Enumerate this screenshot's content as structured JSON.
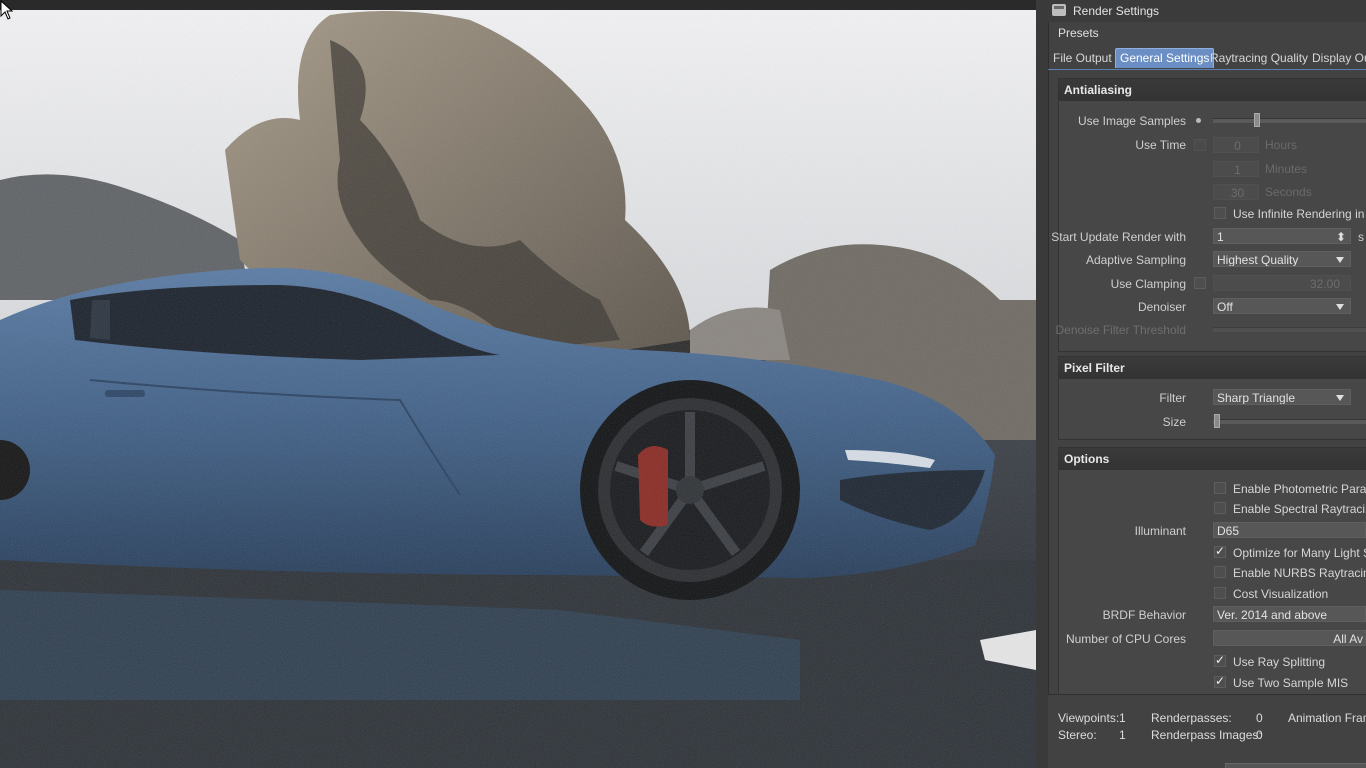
{
  "window": {
    "title": "Render Settings",
    "presets_label": "Presets"
  },
  "tabs": [
    {
      "label": "File Output"
    },
    {
      "label": "General Settings",
      "active": true
    },
    {
      "label": "Raytracing Quality"
    },
    {
      "label": "Display Ou"
    }
  ],
  "antialiasing": {
    "header": "Antialiasing",
    "use_image_samples": "Use Image Samples",
    "use_time": "Use Time",
    "hours_value": "0",
    "hours_unit": "Hours",
    "minutes_value": "1",
    "minutes_unit": "Minutes",
    "seconds_value": "30",
    "seconds_unit": "Seconds",
    "use_infinite": "Use Infinite Rendering in V",
    "start_update_label": "Start Update Render with",
    "start_update_value": "1",
    "start_update_unit": "s",
    "adaptive_label": "Adaptive Sampling",
    "adaptive_value": "Highest Quality",
    "clamping_label": "Use Clamping",
    "clamping_value": "32.00",
    "denoiser_label": "Denoiser",
    "denoiser_value": "Off",
    "denoise_threshold_label": "Denoise Filter Threshold"
  },
  "pixel_filter": {
    "header": "Pixel Filter",
    "filter_label": "Filter",
    "filter_value": "Sharp Triangle",
    "size_label": "Size"
  },
  "options": {
    "header": "Options",
    "photometric": "Enable Photometric Param",
    "spectral": "Enable Spectral Raytracing",
    "illuminant_label": "Illuminant",
    "illuminant_value": "D65",
    "optimize_lights": "Optimize for Many Light S",
    "nurbs": "Enable NURBS Raytracing",
    "cost_vis": "Cost Visualization",
    "brdf_label": "BRDF Behavior",
    "brdf_value": "Ver. 2014 and above",
    "cpu_label": "Number of CPU Cores",
    "cpu_value": "All Av",
    "ray_splitting": "Use Ray Splitting",
    "two_sample_mis": "Use Two Sample MIS"
  },
  "status": {
    "viewpoints_label": "Viewpoints:",
    "viewpoints_value": "1",
    "stereo_label": "Stereo:",
    "stereo_value": "1",
    "renderpasses_label": "Renderpasses:",
    "renderpasses_value": "0",
    "renderpass_images_label": "Renderpass Images:",
    "renderpass_images_value": "0",
    "animation_label": "Animation Fram"
  },
  "viewport": {
    "car_color": "#3f5f86",
    "sky_color": "#ecedef"
  }
}
